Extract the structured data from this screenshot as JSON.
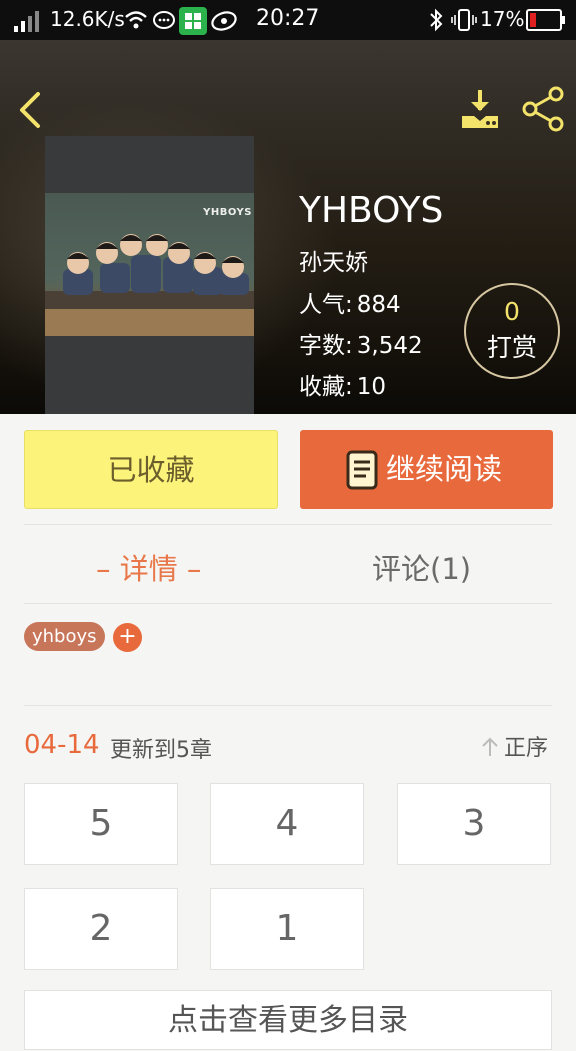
{
  "status_bar": {
    "speed": "12.6K/s",
    "time": "20:27",
    "battery": "17%"
  },
  "hero": {
    "cover_brand": "YHBOYS",
    "title": "YHBOYS",
    "author": "孙天娇",
    "stats": [
      {
        "label": "人气:",
        "value": "884"
      },
      {
        "label": "字数:",
        "value": "3,542"
      },
      {
        "label": "收藏:",
        "value": "10"
      }
    ],
    "tip": {
      "count": "0",
      "label": "打赏"
    }
  },
  "actions": {
    "favorite_label": "已收藏",
    "read_label": "继续阅读"
  },
  "tabs": {
    "details": "– 详情 –",
    "comments": "评论(1)"
  },
  "tags": {
    "items": [
      "yhboys"
    ],
    "add_label": "+"
  },
  "updates": {
    "date": "04-14",
    "text": "更新到5章",
    "sort_label": "正序"
  },
  "chapters": [
    "5",
    "4",
    "3",
    "2",
    "1"
  ],
  "more_label": "点击查看更多目录",
  "colors": {
    "accent_orange": "#e8693b",
    "favorite_yellow": "#fcf47a",
    "icon_yellow": "#f4e36a"
  }
}
